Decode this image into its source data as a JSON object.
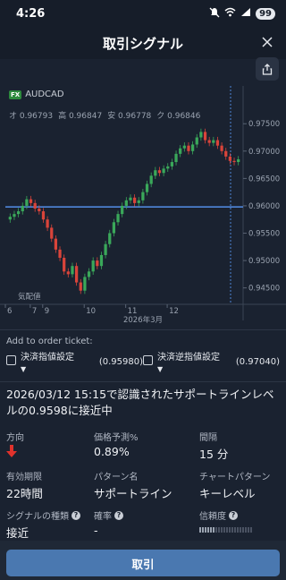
{
  "status_bar": {
    "time": "4:26",
    "battery": "99"
  },
  "header": {
    "title": "取引シグナル"
  },
  "chart": {
    "symbol_badge": "FX",
    "symbol": "AUDCAD",
    "ohlc": {
      "open": "オ 0.96793",
      "high": "高 0.96847",
      "low": "安 0.96778",
      "close": "ク 0.96846"
    },
    "price_ticks": [
      "0.97500",
      "0.97000",
      "0.96500",
      "0.96000",
      "0.95500",
      "0.95000",
      "0.94500"
    ],
    "date_ticks": [
      "6",
      "7",
      "9",
      "10",
      "11",
      "12"
    ],
    "month_label": "2026年3月",
    "validity_label": "気配値",
    "support_level": 0.9598
  },
  "chart_data": {
    "type": "candlestick",
    "x": [
      "6",
      "7",
      "9",
      "10",
      "11",
      "12"
    ],
    "ylim": [
      0.942,
      0.977
    ],
    "support_line": 0.9598,
    "series": [
      {
        "values": [
          0.958,
          0.9585,
          0.959,
          0.96,
          0.9612,
          0.9605,
          0.9595,
          0.959,
          0.9575,
          0.956,
          0.954,
          0.952,
          0.9505,
          0.948,
          0.9475,
          0.949,
          0.946,
          0.9445,
          0.947,
          0.948,
          0.95,
          0.949,
          0.951,
          0.953,
          0.955,
          0.957,
          0.9585,
          0.96,
          0.961,
          0.9615,
          0.9605,
          0.961,
          0.9625,
          0.964,
          0.9655,
          0.9665,
          0.966,
          0.9668,
          0.9672,
          0.968,
          0.9695,
          0.9705,
          0.971,
          0.97,
          0.9712,
          0.9725,
          0.9735,
          0.972,
          0.9715,
          0.972,
          0.971,
          0.97,
          0.969,
          0.9682,
          0.968,
          0.9685
        ]
      }
    ]
  },
  "order_ticket": {
    "title": "Add to order ticket:",
    "take_profit": {
      "label": "決済指値設定",
      "value": "(0.95980)"
    },
    "stop_loss": {
      "label": "決済逆指値設定",
      "value": "(0.97040)"
    }
  },
  "signal": {
    "message": "2026/03/12 15:15で認識されたサポートラインレベルの0.9598に接近中",
    "direction_label": "方向",
    "direction": "down",
    "prediction_label": "価格予測%",
    "prediction_value": "0.89%",
    "interval_label": "間隔",
    "interval_value": "15 分",
    "expiry_label": "有効期限",
    "expiry_value": "22時間",
    "pattern_name_label": "パターン名",
    "pattern_name_value": "サポートライン",
    "chart_pattern_label": "チャートパターン",
    "chart_pattern_value": "キーレベル",
    "signal_type_label": "シグナルの種類",
    "signal_type_value": "接近",
    "probability_label": "確率",
    "probability_value": "-",
    "confidence_label": "信頼度",
    "confidence_level": 0.3
  },
  "footer": {
    "cancel_label": "取引"
  },
  "colors": {
    "background": "#1a2230",
    "up_candle": "#3aa85a",
    "down_candle": "#d9443a",
    "support_line": "#4f86d9",
    "button": "#4a78b0",
    "direction_arrow": "#e0322c"
  }
}
